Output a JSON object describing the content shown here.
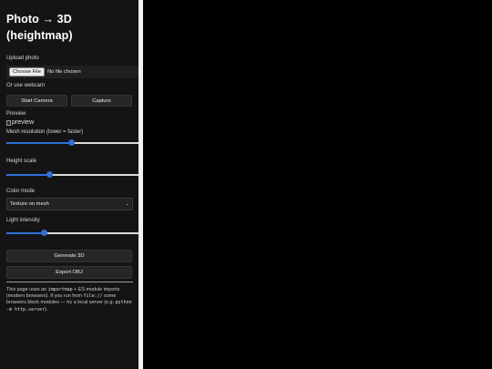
{
  "sidebar": {
    "title": "Photo → 3D (heightmap)",
    "upload": {
      "label": "Upload photo",
      "button": "Choose File",
      "status": "No file chosen"
    },
    "webcam": {
      "label": "Or use webcam",
      "start_button": "Start Camera",
      "capture_button": "Capture"
    },
    "preview": {
      "label": "Preview",
      "alt_text": "preview"
    },
    "mesh_resolution": {
      "label": "Mesh resolution (lower = faster)",
      "value_fraction": 0.47
    },
    "height_scale": {
      "label": "Height scale",
      "value_fraction": 0.31
    },
    "color_mode": {
      "label": "Color mode",
      "selected": "Texture on mesh"
    },
    "light_intensity": {
      "label": "Light intensity",
      "value_fraction": 0.27
    },
    "generate_button": "Generate 3D",
    "export_button": "Export OBJ",
    "note": {
      "p1": "This page uses an ",
      "c1": "importmap",
      "p2": " + ES module imports (modern browsers). If you run from ",
      "c2": "file://",
      "p3": " some browsers block modules — try a local server (e.g. ",
      "c3": "python -m http.server",
      "p4": ")."
    }
  },
  "colors": {
    "accent": "#2f6fd6",
    "panel_bg": "#141414",
    "viewport_bg": "#000000"
  }
}
